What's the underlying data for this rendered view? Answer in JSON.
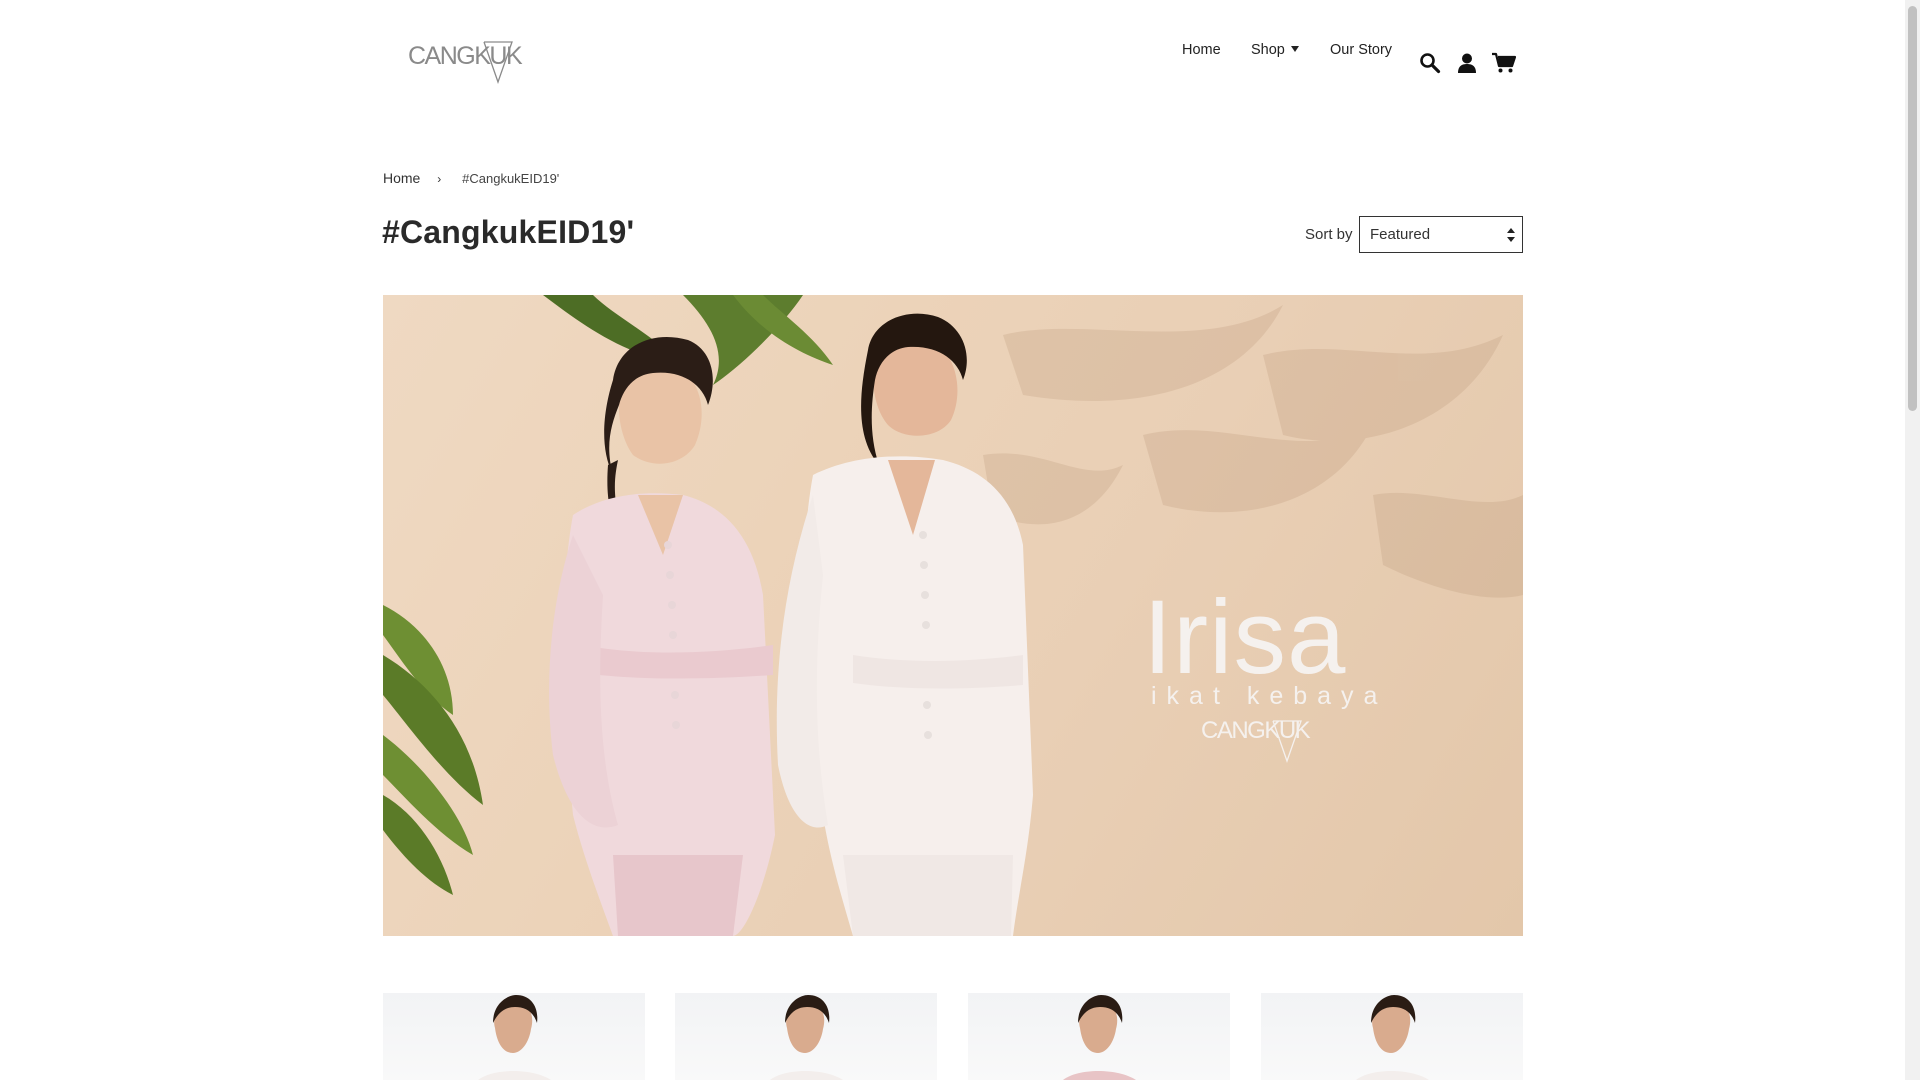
{
  "brand": {
    "logo_text": "CANGKUK"
  },
  "nav": {
    "home_label": "Home",
    "shop_label": "Shop",
    "story_label": "Our Story"
  },
  "header_icons": [
    "search-icon",
    "account-icon",
    "cart-icon"
  ],
  "breadcrumb": {
    "home_label": "Home",
    "separator": "›",
    "current": "#CangkukEID19'"
  },
  "collection": {
    "title": "#CangkukEID19'",
    "sort_label": "Sort by",
    "sort_selected": "Featured"
  },
  "hero": {
    "title": "Irisa",
    "subtitle": "ikat kebaya",
    "brand": "CANGKUK"
  },
  "products": [
    {
      "image": "model-product-image"
    },
    {
      "image": "model-product-image"
    },
    {
      "image": "model-product-image"
    },
    {
      "image": "model-product-image"
    }
  ],
  "colors": {
    "text": "#333333",
    "hero_bg": "#ecd3b9",
    "hero_text": "#f5f1ee",
    "logo": "#8a8a8a"
  }
}
